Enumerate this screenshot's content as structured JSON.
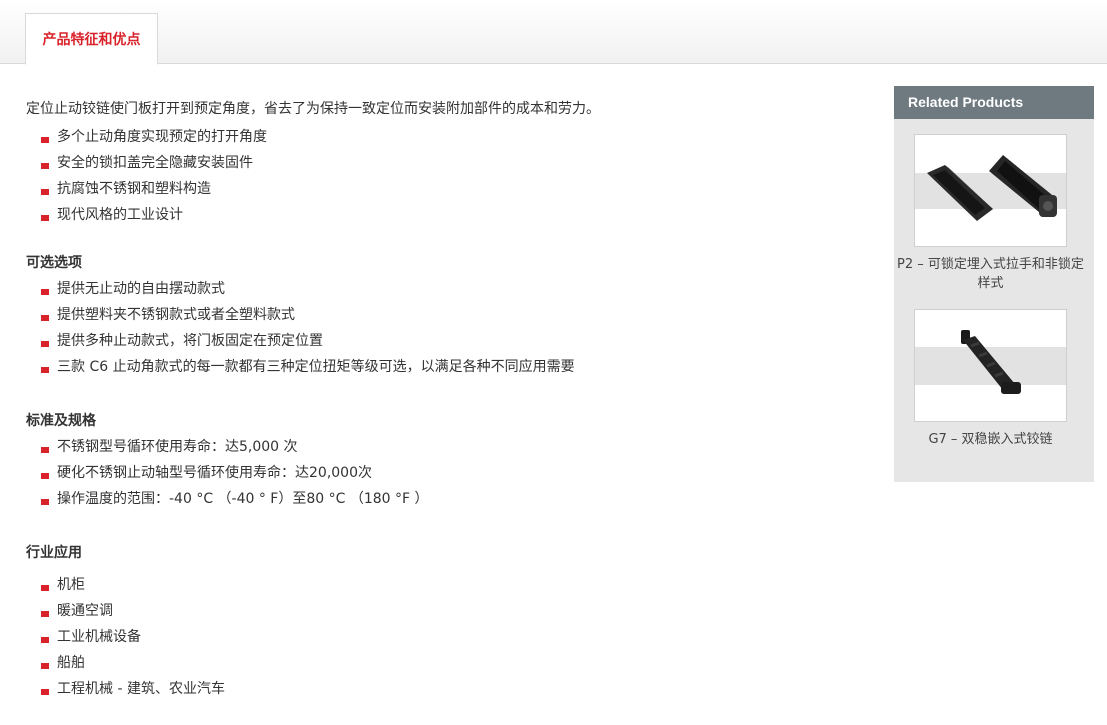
{
  "tabs": [
    {
      "label": "产品特征和优点",
      "active": true
    }
  ],
  "intro": "定位止动铰链使门板打开到预定角度，省去了为保持一致定位而安装附加部件的成本和劳力。",
  "features": [
    "多个止动角度实现预定的打开角度",
    "安全的锁扣盖完全隐藏安装固件",
    "抗腐蚀不锈钢和塑料构造",
    "现代风格的工业设计"
  ],
  "options": {
    "title": "可选选项",
    "items": [
      "提供无止动的自由摆动款式",
      "提供塑料夹不锈钢款式或者全塑料款式",
      "提供多种止动款式，将门板固定在预定位置",
      "三款 C6 止动角款式的每一款都有三种定位扭矩等级可选，以满足各种不同应用需要"
    ]
  },
  "specs": {
    "title": "标准及规格",
    "items": [
      "不锈钢型号循环使用寿命：达5,000 次",
      "硬化不锈钢止动轴型号循环使用寿命：达20,000次",
      "操作温度的范围：-40 °C （-40 ° F）至80 °C （180 °F ）"
    ]
  },
  "applications": {
    "title": "行业应用",
    "items": [
      "机柜",
      "暖通空调",
      "工业机械设备",
      "船舶",
      "工程机械 - 建筑、农业汽车"
    ]
  },
  "related": {
    "title": "Related Products",
    "products": [
      {
        "label": "P2 – 可锁定埋入式拉手和非锁定样式",
        "icon": "flush-pull-handle-image"
      },
      {
        "label": "G7 – 双稳嵌入式铰链",
        "icon": "embedded-hinge-image"
      }
    ]
  },
  "colors": {
    "accent": "#d8232a",
    "sidebar_header": "#6f7a80",
    "sidebar_bg": "#e6e6e6",
    "text": "#333333"
  }
}
